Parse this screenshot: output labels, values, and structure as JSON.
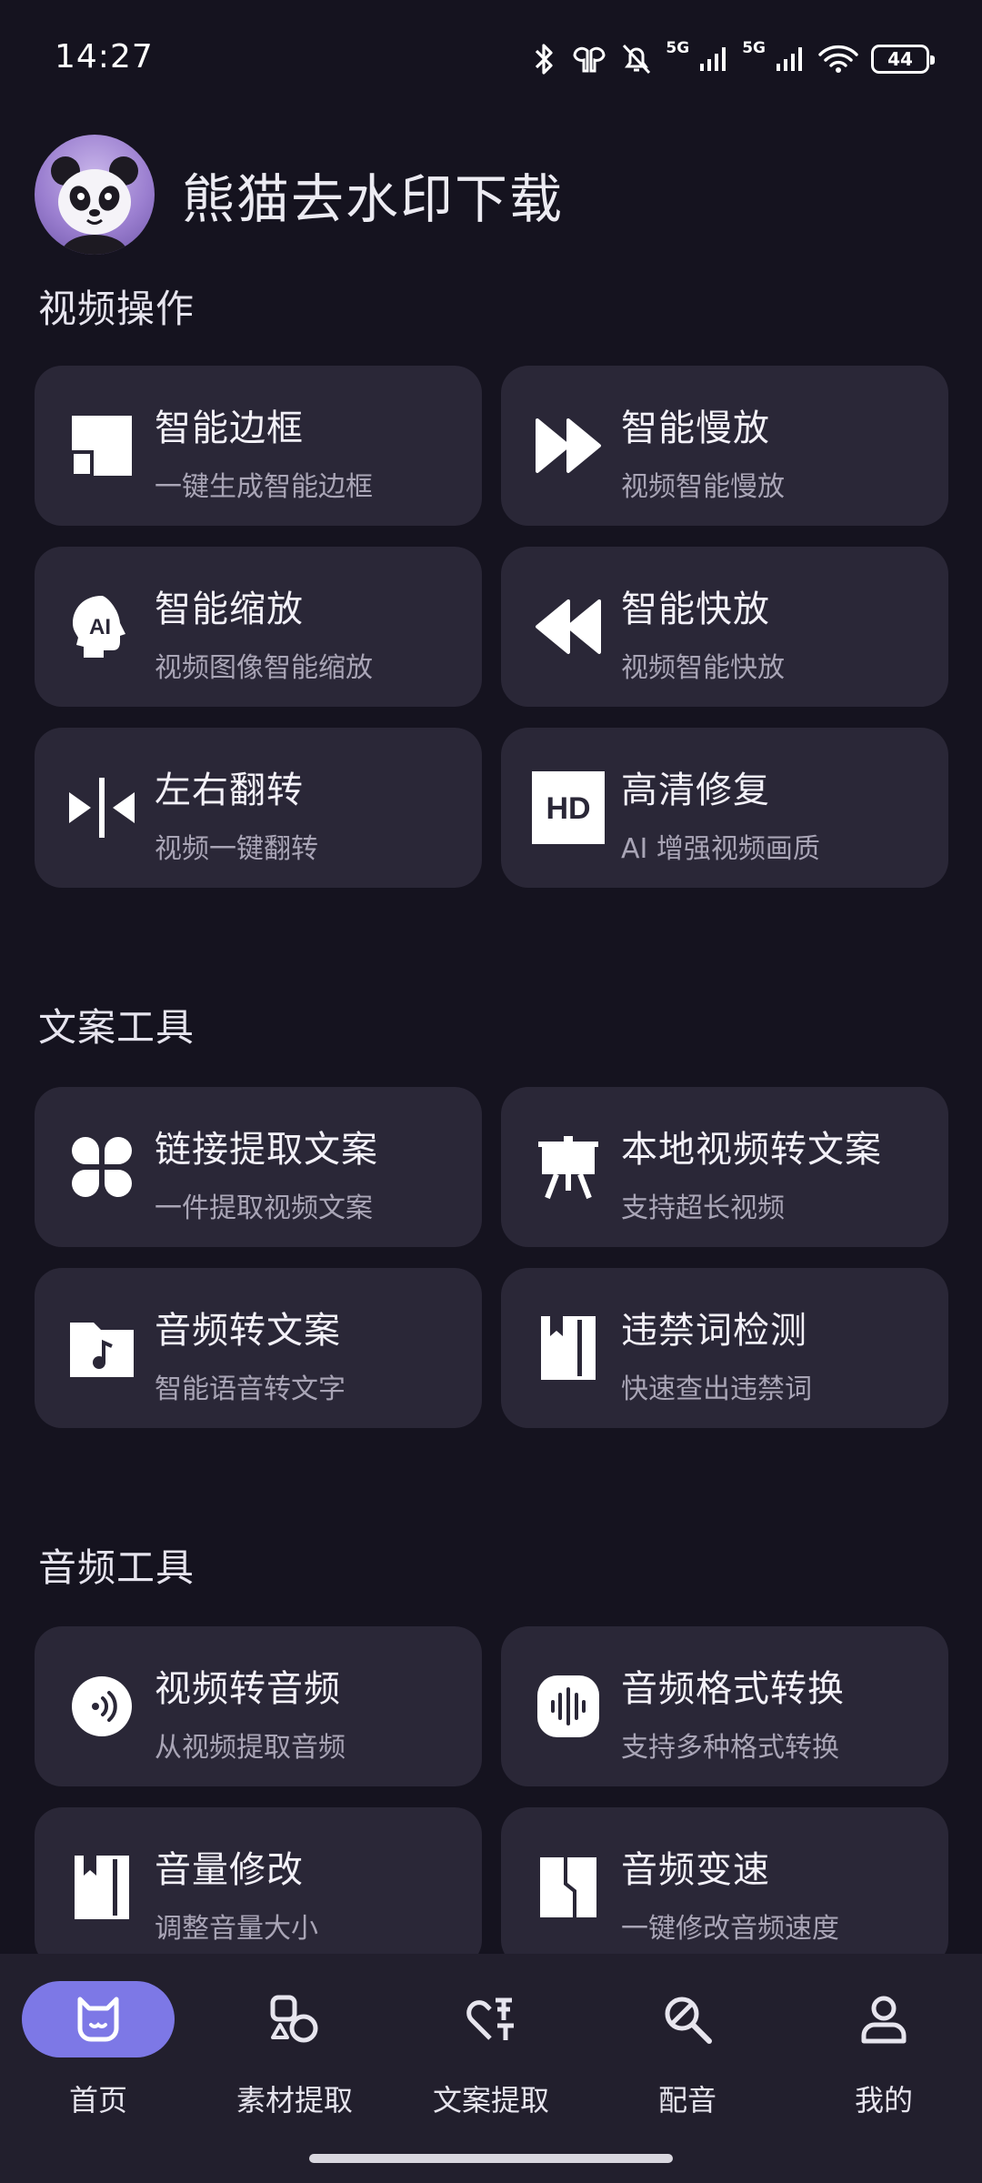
{
  "status_bar": {
    "time": "14:27",
    "network_1": "5G",
    "network_2": "5G",
    "battery": "44",
    "icons": [
      "bluetooth-icon",
      "earbuds-icon",
      "mute-bell-icon",
      "signal-icon",
      "signal-icon",
      "wifi-icon",
      "battery-icon"
    ]
  },
  "header": {
    "title": "熊猫去水印下载",
    "avatar": "panda-avatar"
  },
  "sections": [
    {
      "title": "视频操作",
      "cards": [
        {
          "title": "智能边框",
          "subtitle": "一键生成智能边框",
          "icon": "frame-icon"
        },
        {
          "title": "智能慢放",
          "subtitle": "视频智能慢放",
          "icon": "fast-forward-icon"
        },
        {
          "title": "智能缩放",
          "subtitle": "视频图像智能缩放",
          "icon": "ai-head-icon",
          "icon_text": "AI"
        },
        {
          "title": "智能快放",
          "subtitle": "视频智能快放",
          "icon": "rewind-icon"
        },
        {
          "title": "左右翻转",
          "subtitle": "视频一键翻转",
          "icon": "flip-icon"
        },
        {
          "title": "高清修复",
          "subtitle": "AI 增强视频画质",
          "icon": "hd-icon",
          "icon_text": "HD"
        }
      ]
    },
    {
      "title": "文案工具",
      "cards": [
        {
          "title": "链接提取文案",
          "subtitle": "一件提取视频文案",
          "icon": "clover-icon"
        },
        {
          "title": "本地视频转文案",
          "subtitle": "支持超长视频",
          "icon": "easel-icon"
        },
        {
          "title": "音频转文案",
          "subtitle": "智能语音转文字",
          "icon": "music-folder-icon"
        },
        {
          "title": "违禁词检测",
          "subtitle": "快速查出违禁词",
          "icon": "bookmark-book-icon"
        }
      ]
    },
    {
      "title": "音频工具",
      "cards": [
        {
          "title": "视频转音频",
          "subtitle": "从视频提取音频",
          "icon": "audio-wave-circle-icon"
        },
        {
          "title": "音频格式转换",
          "subtitle": "支持多种格式转换",
          "icon": "waveform-icon"
        },
        {
          "title": "音量修改",
          "subtitle": "调整音量大小",
          "icon": "volume-book-icon"
        },
        {
          "title": "音频变速",
          "subtitle": "一键修改音频速度",
          "icon": "speed-shape-icon"
        }
      ]
    }
  ],
  "bottom_nav": [
    {
      "label": "首页",
      "icon": "home-cat-icon",
      "active": true
    },
    {
      "label": "素材提取",
      "icon": "shapes-icon",
      "active": false
    },
    {
      "label": "文案提取",
      "icon": "heart-text-icon",
      "active": false
    },
    {
      "label": "配音",
      "icon": "mic-search-icon",
      "active": false
    },
    {
      "label": "我的",
      "icon": "person-icon",
      "active": false
    }
  ],
  "colors": {
    "background": "#15131f",
    "card": "#2a2737",
    "nav_bar": "#221f2d",
    "accent": "#7d78e6",
    "subtitle": "#a9a5b6"
  }
}
